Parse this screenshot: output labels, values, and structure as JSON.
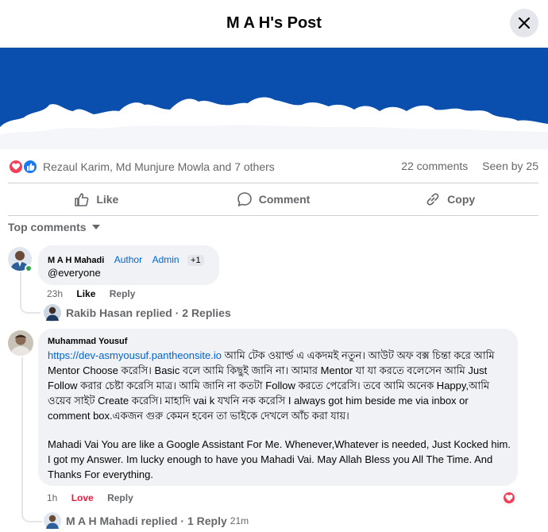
{
  "header": {
    "title": "M A H's Post"
  },
  "reactions": {
    "names": "Rezaul Karim, Md Munjure Mowla and 7 others",
    "comments": "22 comments",
    "seen": "Seen by 25"
  },
  "actions": {
    "like": "Like",
    "comment": "Comment",
    "copy": "Copy"
  },
  "filter": {
    "label": "Top comments"
  },
  "comments": [
    {
      "author": "M A H Mahadi",
      "badge_author": "Author",
      "badge_admin": "Admin",
      "badge_plus": "+1",
      "text": "@everyone",
      "time": "23h",
      "like": "Like",
      "reply": "Reply",
      "replies_summary": "Rakib Hasan replied · 2 Replies"
    },
    {
      "author": "Muhammad Yousuf",
      "link": "https://dev-asmyousuf.pantheonsite.io",
      "text_bn": " আমি টেক ওয়ার্ল্ড এ একদমই নতুন। আউট অফ বক্স চিন্তা করে আমি Mentor Choose করেসি। Basic বলে আমি কিছুই জানি না। আমার Mentor যা যা করতে বলেসেন আমি Just Follow করার চেষ্টা করেসি মাত্র। আমি জানি না কতটা Follow করতে পেরেসি। তবে আমি অনেক Happy,আমি ওয়েব সাইট Create করেসি। মাহাদি vai k যখনি নক করেসি I always got him beside me via inbox or comment box.একজন গুরু কেমন হবেন তা ভাইকে দেখলে আঁচ করা যায়।",
      "text_en": "Mahadi Vai You are like a Google Assistant For Me. Whenever,Whatever is needed, Just Kocked him. I got my Answer. Im lucky enough to have you Mahadi Vai. May Allah Bless you All The Time. And Thanks For everything.",
      "time": "1h",
      "like": "Love",
      "reply": "Reply",
      "replies_summary": "M A H Mahadi replied · 1 Reply",
      "replies_time": "21m"
    }
  ],
  "colors": {
    "brand_blue": "#0a4fae",
    "accent_link": "#0064d1",
    "love_red": "#e41e3f",
    "like_blue": "#1877f2"
  }
}
